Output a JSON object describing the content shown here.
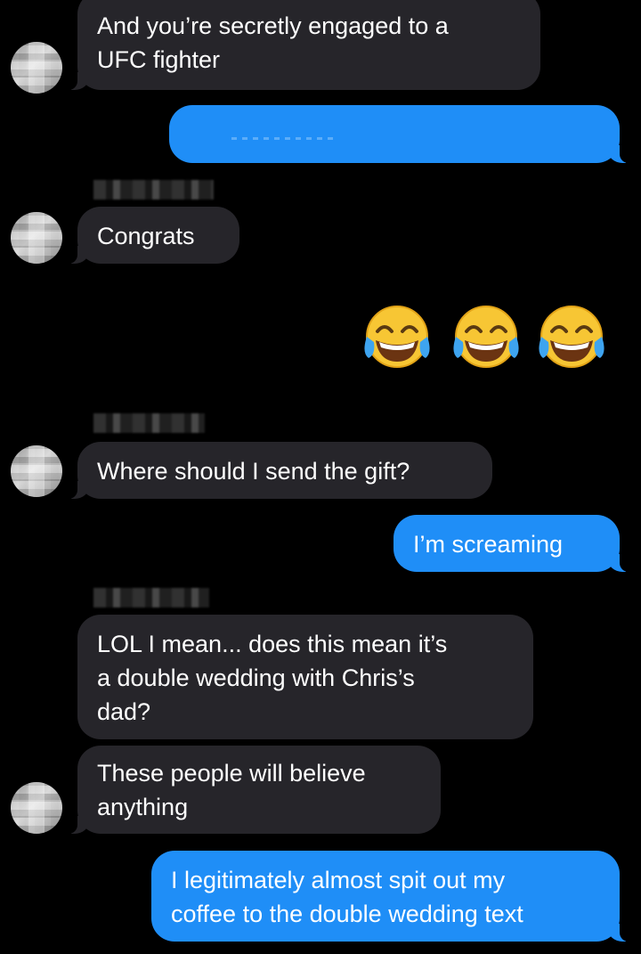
{
  "messages": [
    {
      "type": "incoming",
      "text_lines": [
        "And you’re secretly engaged to a",
        "UFC fighter"
      ]
    },
    {
      "type": "outgoing",
      "text": ""
    },
    {
      "type": "incoming",
      "text": "Congrats"
    },
    {
      "type": "outgoing_emoji",
      "emoji": "😂😂😂"
    },
    {
      "type": "incoming",
      "text": "Where should I send the gift?"
    },
    {
      "type": "outgoing",
      "text": "I’m screaming"
    },
    {
      "type": "incoming",
      "text_lines": [
        "LOL I mean... does this mean it’s",
        "a double wedding with Chris’s",
        "dad?"
      ]
    },
    {
      "type": "incoming",
      "text_lines": [
        "These people will believe",
        "anything"
      ]
    },
    {
      "type": "outgoing",
      "text_lines": [
        "I legitimately almost spit out my",
        "coffee to the double wedding text"
      ]
    }
  ],
  "colors": {
    "background": "#000000",
    "incoming_bubble": "#26252a",
    "outgoing_bubble": "#1f8ef7",
    "text": "#ffffff"
  },
  "icons": {
    "avatar": "avatar-icon",
    "emoji": "tears-of-joy-emoji"
  }
}
